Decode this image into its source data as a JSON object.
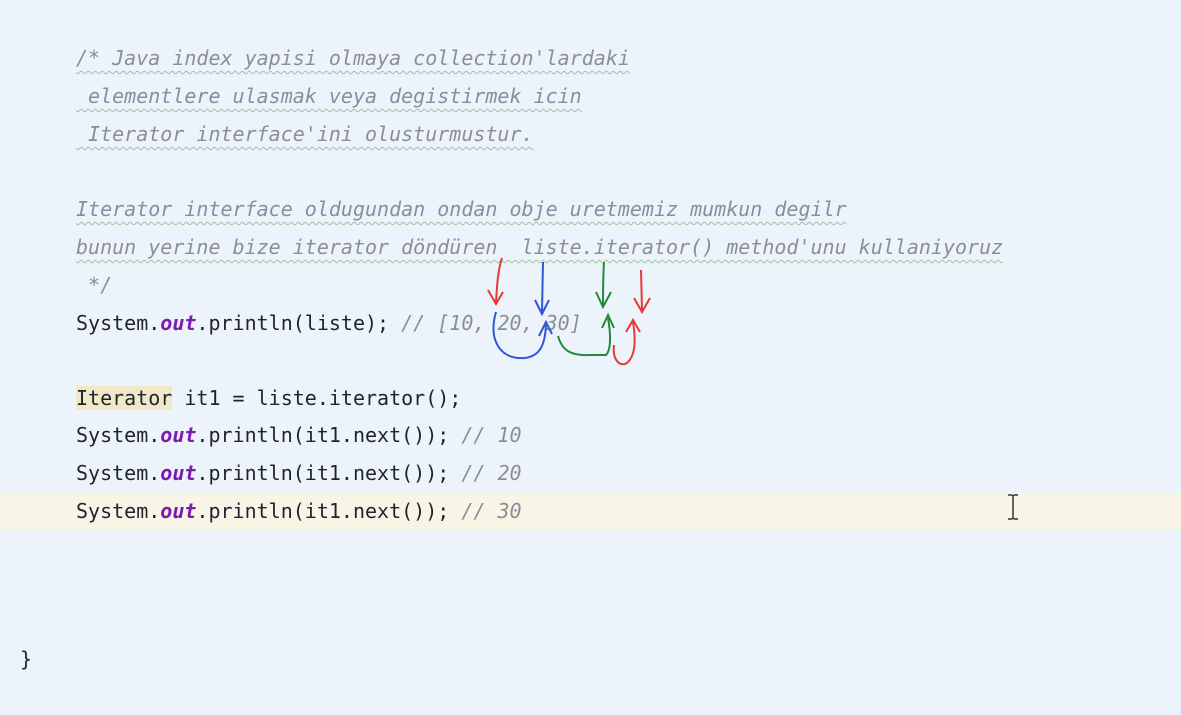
{
  "editor": {
    "lines": {
      "c1": "/* Java index yapisi olmaya collection'lardaki",
      "c2": " elementlere ulasmak veya degistirmek icin",
      "c3": " Iterator interface'ini olusturmustur.",
      "c4": "Iterator interface oldugundan ondan obje uretmemiz mumkun degilr",
      "c5": "bunun yerine bize iterator döndüren  liste.iterator() method'unu kullaniyoruz",
      "c6": " */",
      "print_liste": {
        "prefix": "System.",
        "field": "out",
        "suffix": ".println(liste); ",
        "comment": "// [10, 20, 30]"
      },
      "iterator_decl": {
        "type": "Iterator",
        "rest": " it1 = liste.iterator();"
      },
      "next1": {
        "prefix": "System.",
        "field": "out",
        "suffix": ".println(it1.next()); ",
        "comment": "// 10"
      },
      "next2": {
        "prefix": "System.",
        "field": "out",
        "suffix": ".println(it1.next()); ",
        "comment": "// 20"
      },
      "next3": {
        "prefix": "System.",
        "field": "out",
        "suffix": ".println(it1.next()); ",
        "comment": "// 30"
      },
      "closing_brace": "}"
    },
    "cursor": "text-ibeam-cursor",
    "annotation_colors": {
      "red": "#e53a35",
      "blue": "#2f55d6",
      "green": "#238a3c"
    }
  }
}
